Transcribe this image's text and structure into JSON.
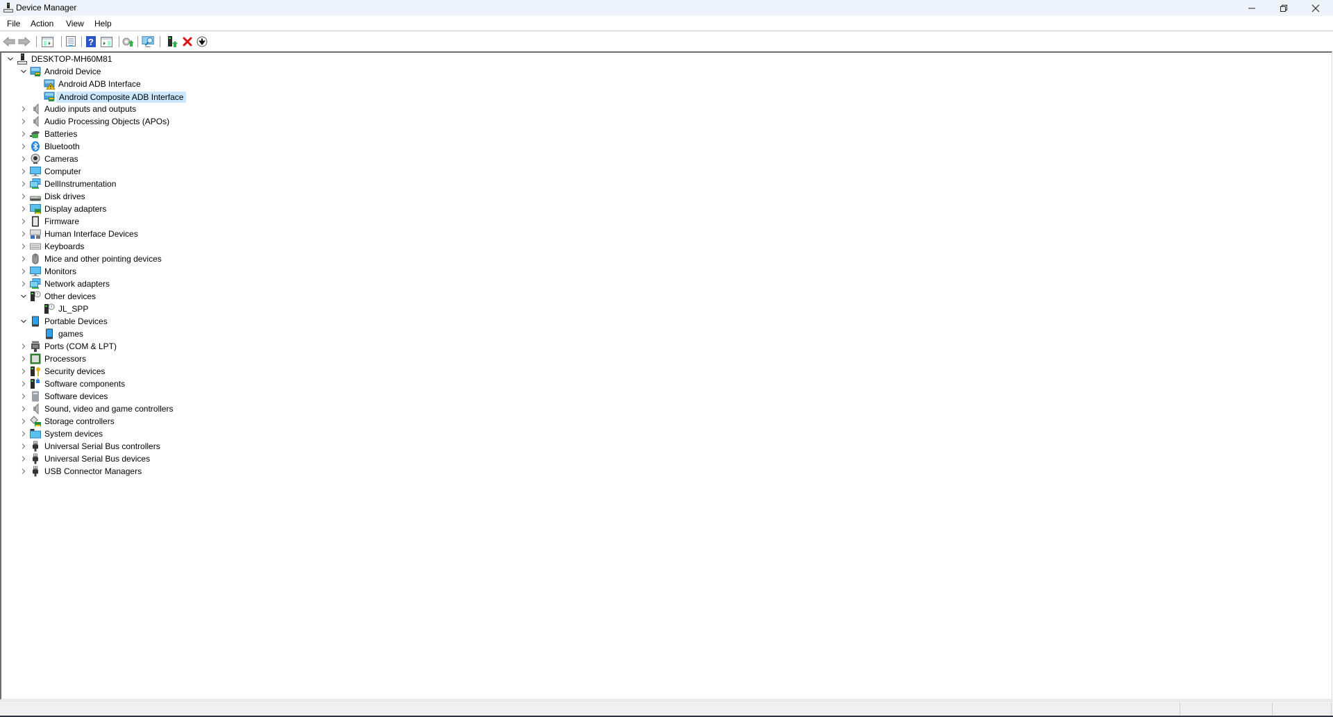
{
  "window": {
    "title": "Device Manager",
    "controls": [
      "minimize",
      "restore",
      "close"
    ]
  },
  "menu": {
    "items": [
      "File",
      "Action",
      "View",
      "Help"
    ]
  },
  "toolbar": {
    "buttons": [
      {
        "name": "back",
        "icon": "back-arrow-icon"
      },
      {
        "name": "forward",
        "icon": "forward-arrow-icon"
      },
      {
        "name": "show-hide-console-tree",
        "icon": "console-tree-icon"
      },
      {
        "name": "properties",
        "icon": "properties-icon"
      },
      {
        "name": "help",
        "icon": "help-icon"
      },
      {
        "name": "show-action-pane",
        "icon": "action-pane-icon"
      },
      {
        "name": "update-driver",
        "icon": "update-driver-icon"
      },
      {
        "name": "scan-hardware-changes",
        "icon": "scan-monitor-icon"
      },
      {
        "name": "add-legacy-hardware",
        "icon": "add-device-icon"
      },
      {
        "name": "uninstall-device",
        "icon": "uninstall-x-icon"
      },
      {
        "name": "disable-device",
        "icon": "disable-down-icon"
      }
    ]
  },
  "tree": {
    "root": "DESKTOP-MH60M81",
    "items": [
      {
        "label": "DESKTOP-MH60M81",
        "level": 0,
        "state": "expanded",
        "icon": "computer-tower-icon"
      },
      {
        "label": "Android Device",
        "level": 1,
        "state": "expanded",
        "icon": "android-device-icon"
      },
      {
        "label": "Android ADB Interface",
        "level": 2,
        "state": "leaf",
        "icon": "android-device-warning-icon"
      },
      {
        "label": "Android Composite ADB Interface",
        "level": 2,
        "state": "leaf",
        "icon": "android-device-icon",
        "selected": true
      },
      {
        "label": "Audio inputs and outputs",
        "level": 1,
        "state": "collapsed",
        "icon": "speaker-icon"
      },
      {
        "label": "Audio Processing Objects (APOs)",
        "level": 1,
        "state": "collapsed",
        "icon": "speaker-icon"
      },
      {
        "label": "Batteries",
        "level": 1,
        "state": "collapsed",
        "icon": "battery-icon"
      },
      {
        "label": "Bluetooth",
        "level": 1,
        "state": "collapsed",
        "icon": "bluetooth-icon"
      },
      {
        "label": "Cameras",
        "level": 1,
        "state": "collapsed",
        "icon": "camera-icon"
      },
      {
        "label": "Computer",
        "level": 1,
        "state": "collapsed",
        "icon": "monitor-icon"
      },
      {
        "label": "DellInstrumentation",
        "level": 1,
        "state": "collapsed",
        "icon": "network-icon"
      },
      {
        "label": "Disk drives",
        "level": 1,
        "state": "collapsed",
        "icon": "disk-drive-icon"
      },
      {
        "label": "Display adapters",
        "level": 1,
        "state": "collapsed",
        "icon": "display-adapter-icon"
      },
      {
        "label": "Firmware",
        "level": 1,
        "state": "collapsed",
        "icon": "chip-icon"
      },
      {
        "label": "Human Interface Devices",
        "level": 1,
        "state": "collapsed",
        "icon": "hid-icon"
      },
      {
        "label": "Keyboards",
        "level": 1,
        "state": "collapsed",
        "icon": "keyboard-icon"
      },
      {
        "label": "Mice and other pointing devices",
        "level": 1,
        "state": "collapsed",
        "icon": "mouse-icon"
      },
      {
        "label": "Monitors",
        "level": 1,
        "state": "collapsed",
        "icon": "monitor-icon"
      },
      {
        "label": "Network adapters",
        "level": 1,
        "state": "collapsed",
        "icon": "network-icon"
      },
      {
        "label": "Other devices",
        "level": 1,
        "state": "expanded",
        "icon": "unknown-device-icon"
      },
      {
        "label": "JL_SPP",
        "level": 2,
        "state": "leaf",
        "icon": "unknown-device-icon"
      },
      {
        "label": "Portable Devices",
        "level": 1,
        "state": "expanded",
        "icon": "portable-device-icon"
      },
      {
        "label": "games",
        "level": 2,
        "state": "leaf",
        "icon": "portable-device-icon"
      },
      {
        "label": "Ports (COM & LPT)",
        "level": 1,
        "state": "collapsed",
        "icon": "port-icon"
      },
      {
        "label": "Processors",
        "level": 1,
        "state": "collapsed",
        "icon": "processor-icon"
      },
      {
        "label": "Security devices",
        "level": 1,
        "state": "collapsed",
        "icon": "security-key-icon"
      },
      {
        "label": "Software components",
        "level": 1,
        "state": "collapsed",
        "icon": "software-component-icon"
      },
      {
        "label": "Software devices",
        "level": 1,
        "state": "collapsed",
        "icon": "software-device-icon"
      },
      {
        "label": "Sound, video and game controllers",
        "level": 1,
        "state": "collapsed",
        "icon": "speaker-icon"
      },
      {
        "label": "Storage controllers",
        "level": 1,
        "state": "collapsed",
        "icon": "storage-controller-icon"
      },
      {
        "label": "System devices",
        "level": 1,
        "state": "collapsed",
        "icon": "system-folder-icon"
      },
      {
        "label": "Universal Serial Bus controllers",
        "level": 1,
        "state": "collapsed",
        "icon": "usb-plug-icon"
      },
      {
        "label": "Universal Serial Bus devices",
        "level": 1,
        "state": "collapsed",
        "icon": "usb-plug-icon"
      },
      {
        "label": "USB Connector Managers",
        "level": 1,
        "state": "collapsed",
        "icon": "usb-plug-icon"
      }
    ]
  },
  "colors": {
    "selection": "#cce8ff",
    "titlebar": "#eef3fa",
    "statusbar": "#f0f0f0"
  },
  "statusbar": {
    "panes": [
      "",
      "",
      ""
    ]
  }
}
